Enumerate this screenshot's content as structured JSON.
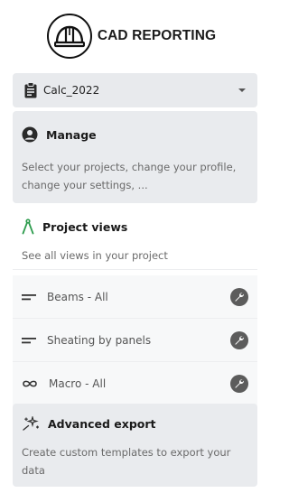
{
  "brand": {
    "title": "CAD REPORTING",
    "logo_icon": "hardhat-logo-icon"
  },
  "project_select": {
    "value": "Calc_2022",
    "icon": "clipboard-icon",
    "caret_icon": "chevron-down-icon"
  },
  "manage": {
    "title": "Manage",
    "description": "Select your projects, change your profile, change your settings, ...",
    "icon": "user-circle-icon"
  },
  "project_views": {
    "title": "Project views",
    "description": "See all views in your project",
    "icon": "compass-icon",
    "items": [
      {
        "label": "Beams - All",
        "icon": "lines-icon",
        "action_icon": "wrench-icon"
      },
      {
        "label": "Sheating by panels",
        "icon": "lines-icon",
        "action_icon": "wrench-icon"
      },
      {
        "label": "Macro - All",
        "icon": "infinity-icon",
        "action_icon": "wrench-icon"
      }
    ]
  },
  "advanced_export": {
    "title": "Advanced export",
    "description": "Create custom templates to export your data",
    "icon": "sparkles-icon"
  },
  "colors": {
    "card_bg": "#e9ebee",
    "accent_green": "#2e9c4e",
    "icon_dark": "#5c5c5c"
  }
}
